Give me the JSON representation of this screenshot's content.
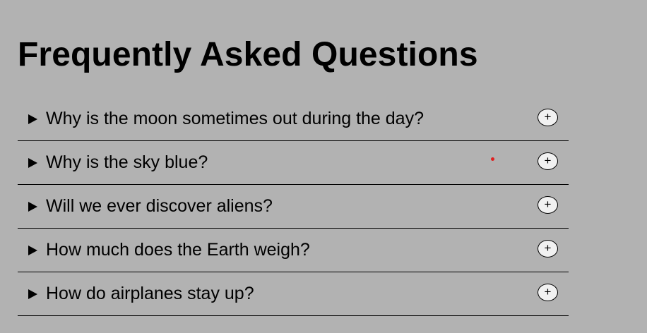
{
  "page": {
    "title": "Frequently Asked Questions"
  },
  "faq": {
    "items": [
      {
        "question": "Why is the moon sometimes out during the day?",
        "toggle": "+",
        "expanded": false
      },
      {
        "question": "Why is the sky blue?",
        "toggle": "+",
        "expanded": false
      },
      {
        "question": "Will we ever discover aliens?",
        "toggle": "+",
        "expanded": false
      },
      {
        "question": "How much does the Earth weigh?",
        "toggle": "+",
        "expanded": false
      },
      {
        "question": "How do airplanes stay up?",
        "toggle": "+",
        "expanded": false
      }
    ]
  },
  "icons": {
    "caret": "caret-right-icon",
    "toggle": "plus-icon"
  },
  "colors": {
    "background": "#b2b2b2",
    "text": "#000000",
    "toggle_fill": "#f1f1f1",
    "cursor_marker": "#e02020"
  }
}
